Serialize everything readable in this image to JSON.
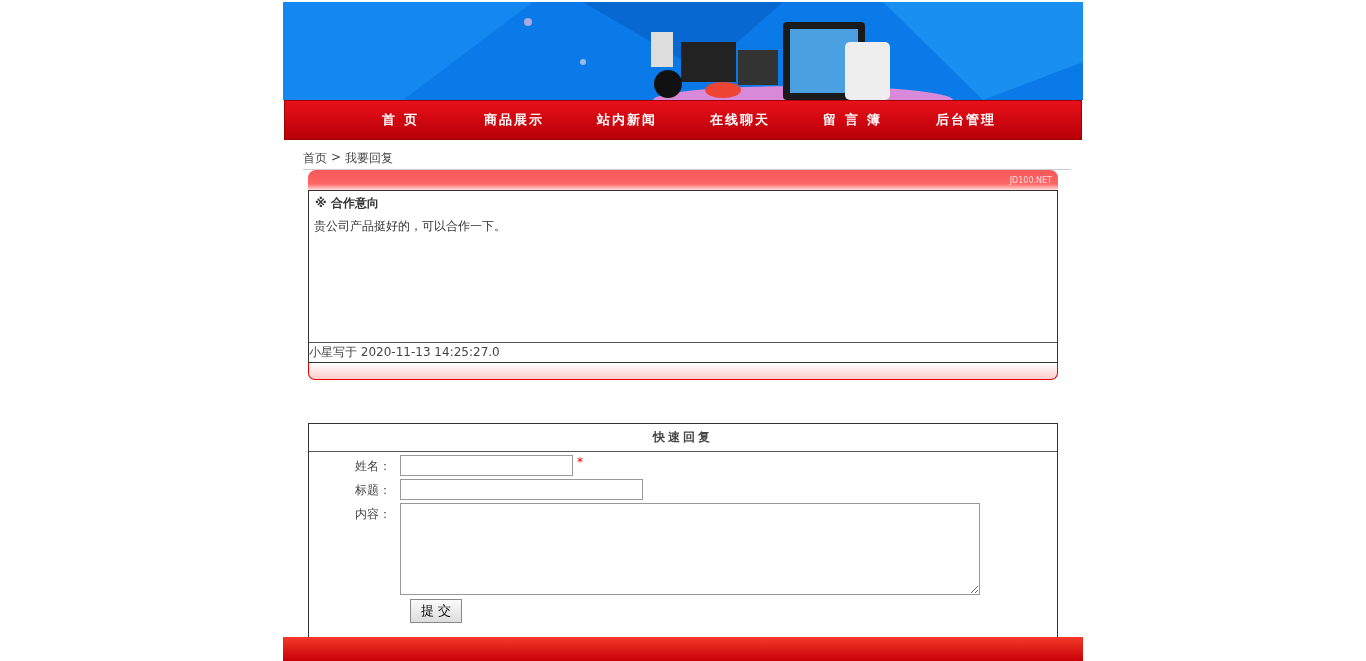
{
  "nav": {
    "items": [
      {
        "label": "首 页"
      },
      {
        "label": "商品展示"
      },
      {
        "label": "站内新闻"
      },
      {
        "label": "在线聊天"
      },
      {
        "label": "留 言 簿"
      },
      {
        "label": "后台管理"
      }
    ]
  },
  "breadcrumb": {
    "home": "首页",
    "separator": ">",
    "current": "我要回复"
  },
  "message": {
    "brand_mark": "JD100.NET",
    "title_mark": "※",
    "title": "合作意向",
    "body": "贵公司产品挺好的，可以合作一下。",
    "footer": "小星写于 2020-11-13 14:25:27.0"
  },
  "reply_form": {
    "title": "快速回复",
    "fields": [
      {
        "kind": "input",
        "label": "姓名：",
        "required": true,
        "required_mark": "*"
      },
      {
        "kind": "input",
        "label": "标题：",
        "required": false
      },
      {
        "kind": "textarea",
        "label": "内容：",
        "required": false
      }
    ],
    "submit": "提 交"
  }
}
